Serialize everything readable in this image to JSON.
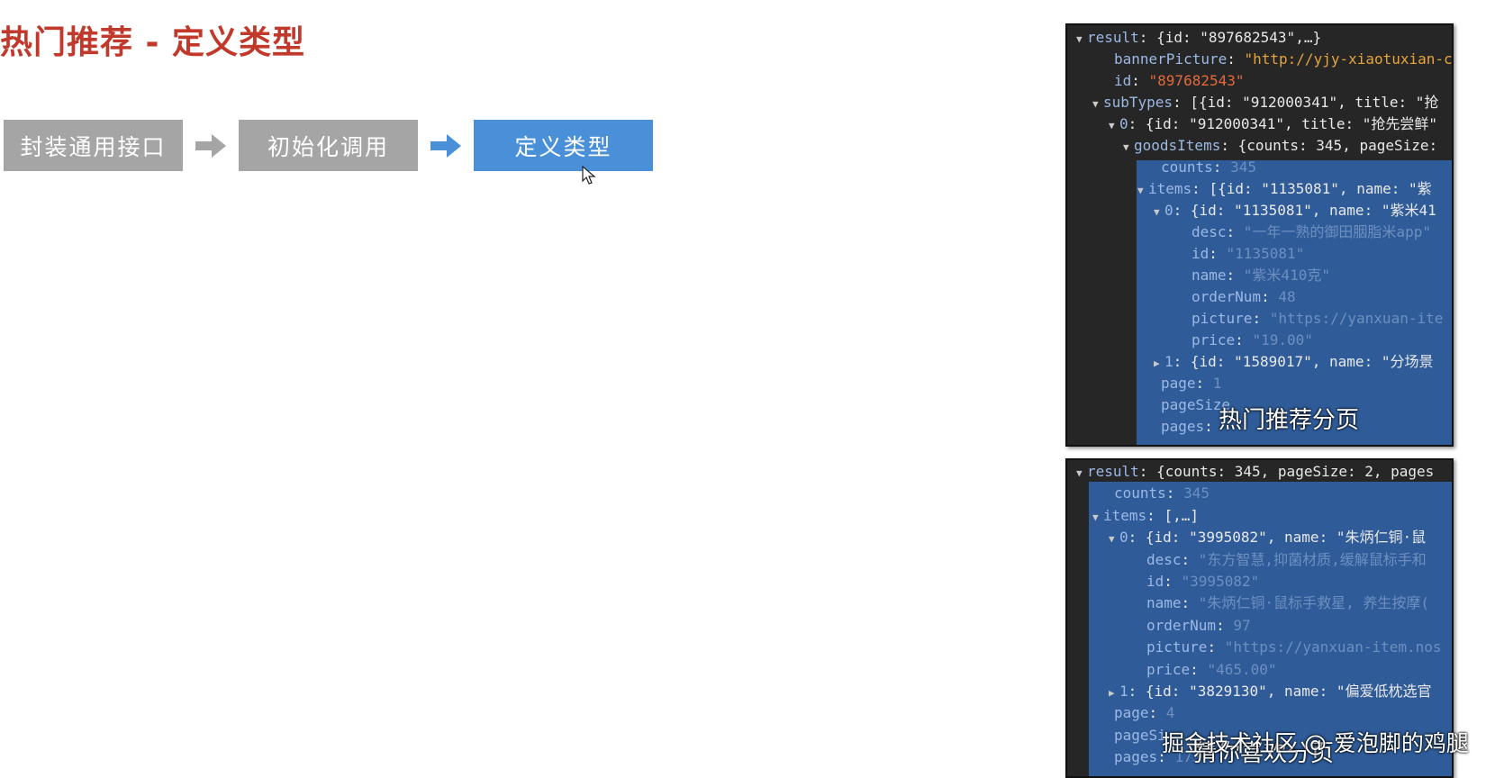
{
  "slide": {
    "title": "热门推荐 - 定义类型"
  },
  "steps": [
    {
      "label": "封装通用接口"
    },
    {
      "label": "初始化调用"
    },
    {
      "label": "定义类型"
    }
  ],
  "colors": {
    "title": "#c0392b",
    "step_gray": "#a5a5a5",
    "step_active": "#4a90d9",
    "panel_bg": "#262626",
    "panel_highlight": "#2f5c99"
  },
  "panel1": {
    "caption": "热门推荐分页",
    "lines": [
      {
        "tri": "▼",
        "key": "result",
        "rest": ": {id: \"897682543\",…}"
      },
      {
        "key": "bannerPicture",
        "rest": ": ",
        "val": "\"http://yjy-xiaotuxian-c",
        "cls": "url"
      },
      {
        "key": "id",
        "rest": ": ",
        "val": "\"897682543\"",
        "cls": "id"
      },
      {
        "tri": "▼",
        "key": "subTypes",
        "rest": ": [{id: \"912000341\", title: \"抢"
      },
      {
        "tri": "▼",
        "key": "0",
        "rest": ": {id: \"912000341\", title: \"抢先尝鲜\""
      },
      {
        "tri": "▼",
        "key": "goodsItems",
        "rest": ": {counts: 345, pageSize:"
      },
      {
        "key": "counts",
        "rest": ": ",
        "val": "345",
        "cls": "dim"
      },
      {
        "tri": "▼",
        "key": "items",
        "rest": ": [{id: \"1135081\", name: \"紫"
      },
      {
        "tri": "▼",
        "key": "0",
        "rest": ": {id: \"1135081\", name: \"紫米41"
      },
      {
        "key": "desc",
        "rest": ": ",
        "val": "\"一年一熟的御田胭脂米app\"",
        "cls": "dim"
      },
      {
        "key": "id",
        "rest": ": ",
        "val": "\"1135081\"",
        "cls": "dim"
      },
      {
        "key": "name",
        "rest": ": ",
        "val": "\"紫米410克\"",
        "cls": "dim"
      },
      {
        "key": "orderNum",
        "rest": ": ",
        "val": "48",
        "cls": "dim"
      },
      {
        "key": "picture",
        "rest": ": ",
        "val": "\"https://yanxuan-ite",
        "cls": "dim"
      },
      {
        "key": "price",
        "rest": ": ",
        "val": "\"19.00\"",
        "cls": "dim"
      },
      {
        "tri": "▶",
        "key": "1",
        "rest": ": {id: \"1589017\", name: \"分场景"
      },
      {
        "key": "page",
        "rest": ": ",
        "val": "1",
        "cls": "dim"
      },
      {
        "key": "pageSize",
        "rest": "",
        "val": "",
        "cls": "dim"
      },
      {
        "key": "pages",
        "rest": ": ",
        "val": "",
        "cls": "dim"
      }
    ]
  },
  "panel2": {
    "caption": "猜你喜欢分页",
    "lines": [
      {
        "tri": "▼",
        "key": "result",
        "rest": ": {counts: 345, pageSize: 2, pages"
      },
      {
        "key": "counts",
        "rest": ": ",
        "val": "345",
        "cls": "dim"
      },
      {
        "tri": "▼",
        "key": "items",
        "rest": ": [,…]"
      },
      {
        "tri": "▼",
        "key": "0",
        "rest": ": {id: \"3995082\", name: \"朱炳仁铜·鼠"
      },
      {
        "key": "desc",
        "rest": ": ",
        "val": "\"东方智慧,抑菌材质,缓解鼠标手和",
        "cls": "dim"
      },
      {
        "key": "id",
        "rest": ": ",
        "val": "\"3995082\"",
        "cls": "dim"
      },
      {
        "key": "name",
        "rest": ": ",
        "val": "\"朱炳仁铜·鼠标手救星, 养生按摩(",
        "cls": "dim"
      },
      {
        "key": "orderNum",
        "rest": ": ",
        "val": "97",
        "cls": "dim"
      },
      {
        "key": "picture",
        "rest": ": ",
        "val": "\"https://yanxuan-item.nos",
        "cls": "dim"
      },
      {
        "key": "price",
        "rest": ": ",
        "val": "\"465.00\"",
        "cls": "dim"
      },
      {
        "tri": "▶",
        "key": "1",
        "rest": ": {id: \"3829130\", name: \"偏爱低枕选官"
      },
      {
        "key": "page",
        "rest": ": ",
        "val": "4",
        "cls": "dim"
      },
      {
        "key": "pageSi",
        "rest": "",
        "val": "",
        "cls": "dim"
      },
      {
        "key": "pages",
        "rest": ": ",
        "val": "173",
        "cls": "dim"
      }
    ]
  },
  "watermark": "掘金技术社区 @ 爱泡脚的鸡腿"
}
